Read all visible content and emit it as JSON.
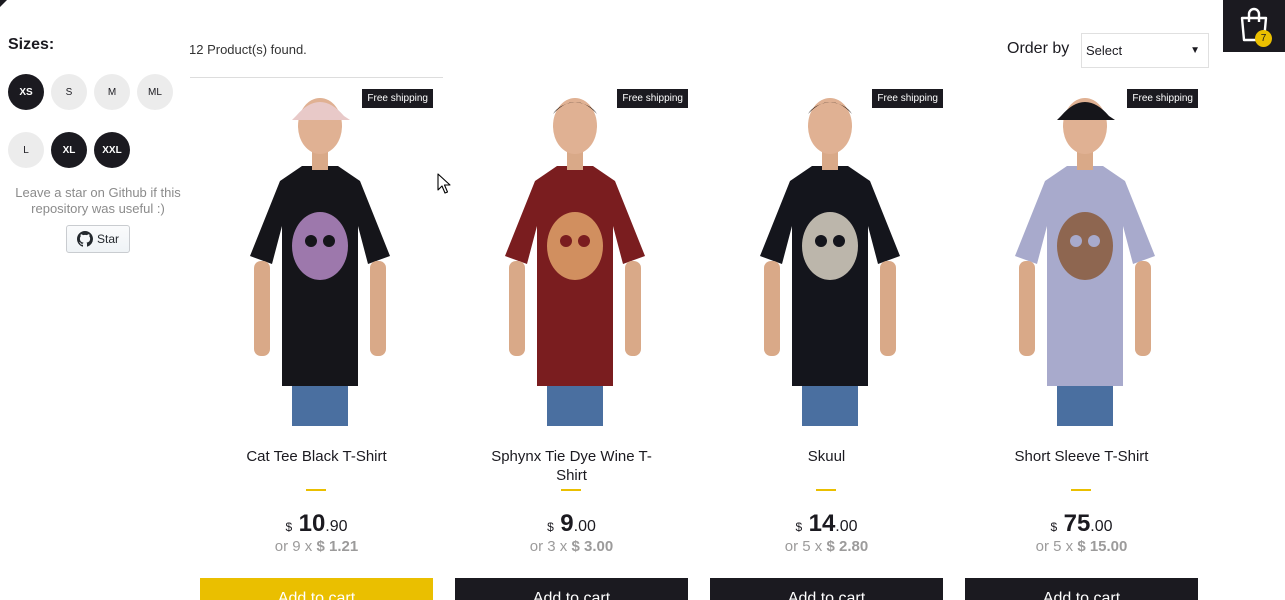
{
  "filters": {
    "title": "Sizes:",
    "sizes": [
      {
        "label": "XS",
        "active": true
      },
      {
        "label": "S",
        "active": false
      },
      {
        "label": "M",
        "active": false
      },
      {
        "label": "ML",
        "active": false
      },
      {
        "label": "L",
        "active": false
      },
      {
        "label": "XL",
        "active": true
      },
      {
        "label": "XXL",
        "active": true
      }
    ],
    "github_note": "Leave a star on Github if this repository was useful :)",
    "star_label": "Star"
  },
  "shelf": {
    "products_found": "12 Product(s) found.",
    "order_label": "Order by",
    "order_selected": "Select"
  },
  "cart": {
    "count": "7"
  },
  "colors": {
    "dark": "#1b1a20",
    "accent": "#eabf00",
    "muted": "#9c9b9b"
  },
  "products": [
    {
      "badge": "Free shipping",
      "title": "Cat Tee Black T-Shirt",
      "currency": "$",
      "price_int": "10",
      "price_dec": ".90",
      "installment_prefix": "or 9 x",
      "installment_value": "$ 1.21",
      "button": "Add to cart",
      "shirt_color": "#15151a",
      "print_color": "#b58ac7",
      "cap": "#e8c9c8"
    },
    {
      "badge": "Free shipping",
      "title": "Sphynx Tie Dye Wine T-Shirt",
      "currency": "$",
      "price_int": "9",
      "price_dec": ".00",
      "installment_prefix": "or 3 x",
      "installment_value": "$ 3.00",
      "button": "Add to cart",
      "shirt_color": "#7a1d1f",
      "print_color": "#e0a36b",
      "cap": ""
    },
    {
      "badge": "Free shipping",
      "title": "Skuul",
      "currency": "$",
      "price_int": "14",
      "price_dec": ".00",
      "installment_prefix": "or 5 x",
      "installment_value": "$ 2.80",
      "button": "Add to cart",
      "shirt_color": "#14151c",
      "print_color": "#d9d2c4",
      "cap": ""
    },
    {
      "badge": "Free shipping",
      "title": "Short Sleeve T-Shirt",
      "currency": "$",
      "price_int": "75",
      "price_dec": ".00",
      "installment_prefix": "or 5 x",
      "installment_value": "$ 15.00",
      "button": "Add to cart",
      "shirt_color": "#a8aacc",
      "print_color": "#8a5a3a",
      "cap": "#15151a"
    }
  ]
}
